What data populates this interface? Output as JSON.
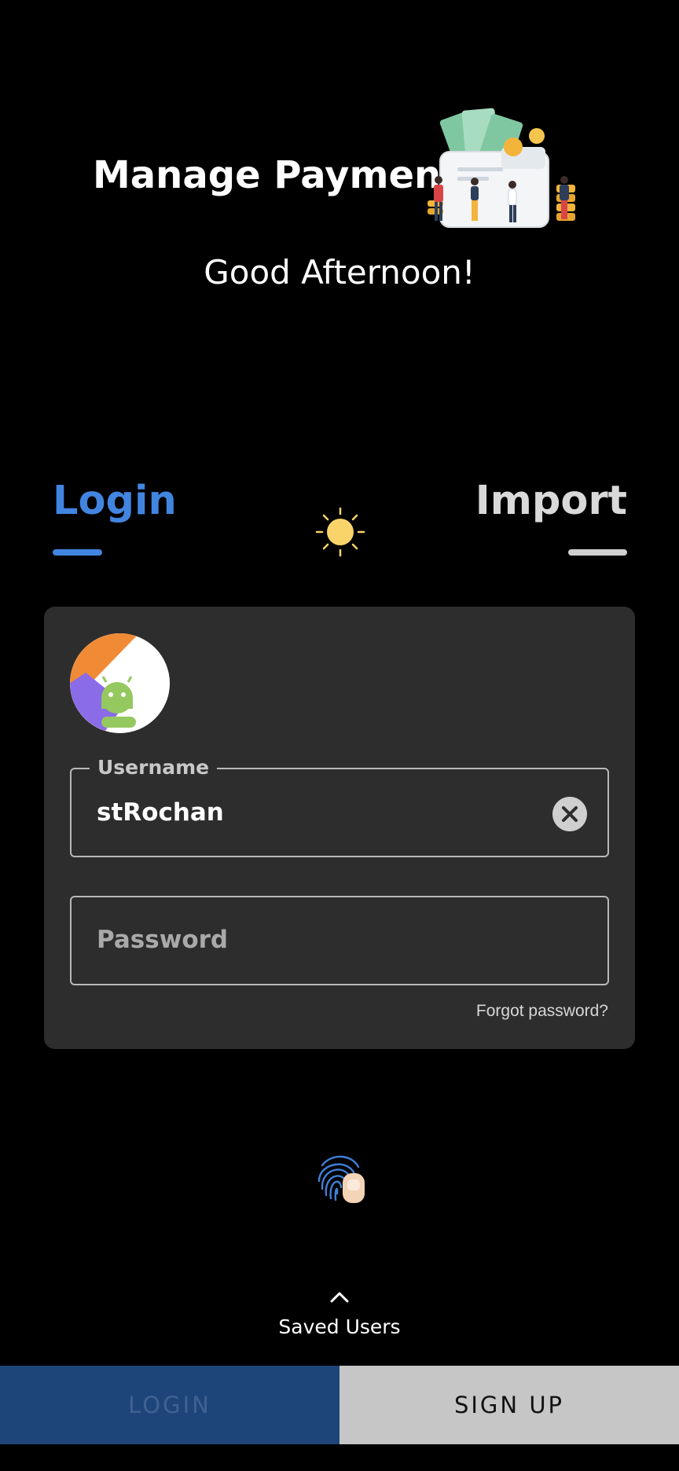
{
  "header": {
    "app_title": "Manage Payments",
    "greeting": "Good Afternoon!",
    "illustration_icon": "payments-illustration"
  },
  "tabs": [
    {
      "label": "Login",
      "active": true
    },
    {
      "label": "Import",
      "active": false
    }
  ],
  "theme_toggle": {
    "icon": "sun-icon"
  },
  "login_card": {
    "avatar_icon": "android-avatar",
    "username": {
      "label": "Username",
      "value": "stRochan"
    },
    "password": {
      "placeholder": "Password",
      "value": ""
    },
    "forgot_password": "Forgot password?"
  },
  "fingerprint": {
    "icon": "fingerprint-icon"
  },
  "saved_users": {
    "label": "Saved Users",
    "icon": "chevron-up-icon"
  },
  "actions": {
    "login": "LOGIN",
    "signup": "SIGN UP"
  },
  "colors": {
    "background": "#000000",
    "accent": "#4285e0",
    "card": "#2d2d2d",
    "login_button": "#1e4579",
    "signup_button": "#c6c6c6"
  }
}
